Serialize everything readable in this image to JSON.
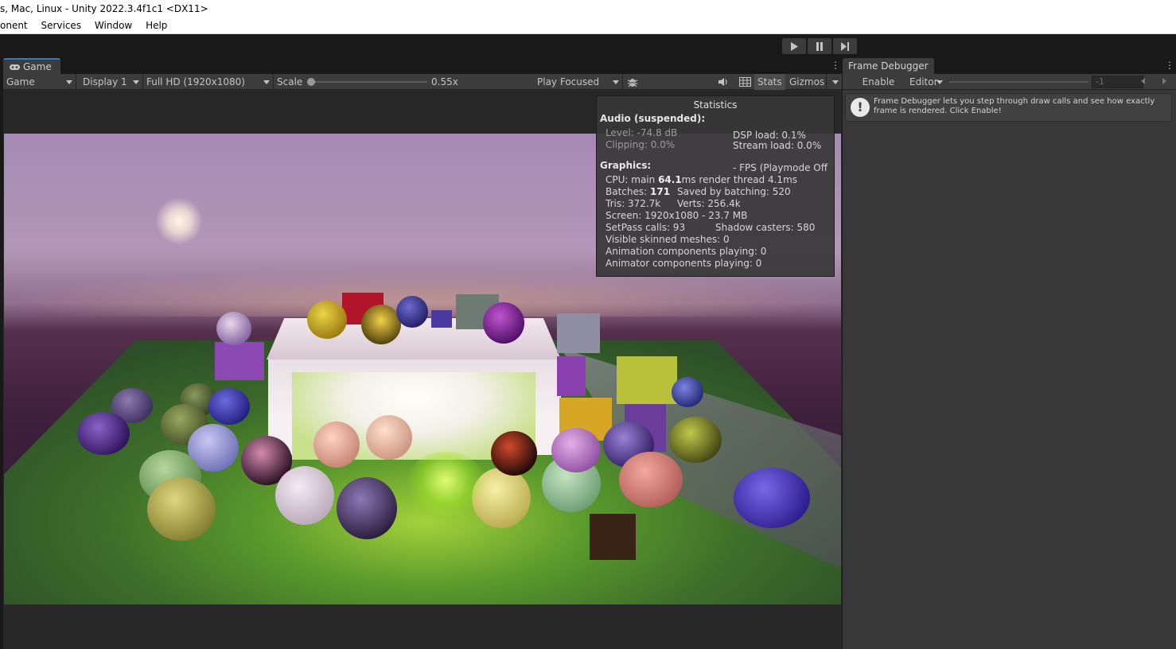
{
  "window": {
    "title": "s, Mac, Linux - Unity 2022.3.4f1c1 <DX11>"
  },
  "menu": {
    "items": [
      "onent",
      "Services",
      "Window",
      "Help"
    ]
  },
  "playbar": {
    "play_icon": "play-icon",
    "pause_icon": "pause-icon",
    "step_icon": "step-icon"
  },
  "game": {
    "tab_label": "Game",
    "view_dropdown": "Game",
    "display_dropdown": "Display 1",
    "resolution_dropdown": "Full HD (1920x1080)",
    "scale_label": "Scale",
    "scale_value": "0.55x",
    "scale_fraction": 0.0,
    "play_mode_dropdown": "Play Focused",
    "stats_label": "Stats",
    "gizmos_label": "Gizmos"
  },
  "statistics": {
    "title": "Statistics",
    "audio_header": "Audio (suspended):",
    "level": "Level: -74.8 dB",
    "clipping": "Clipping: 0.0%",
    "dsp_load": "DSP load: 0.1%",
    "stream_load": "Stream load: 0.0%",
    "graphics_header": "Graphics:",
    "fps": "- FPS (Playmode Off",
    "cpu_prefix": "CPU: main ",
    "cpu_main": "64.1",
    "cpu_suffix": "ms  render thread 4.1ms",
    "batches_prefix": "Batches: ",
    "batches": "171",
    "saved_batching": "Saved by batching: 520",
    "tris": "Tris: 372.7k",
    "verts": "Verts: 256.4k",
    "screen": "Screen: 1920x1080 - 23.7 MB",
    "setpass": "SetPass calls: 93",
    "shadow_casters": "Shadow casters: 580",
    "skinned": "Visible skinned meshes: 0",
    "animation": "Animation components playing: 0",
    "animator": "Animator components playing: 0"
  },
  "frame_debugger": {
    "tab_label": "Frame Debugger",
    "enable_label": "Enable",
    "editor_dropdown": "Editor",
    "event_index": "-1",
    "info_message": "Frame Debugger lets you step through draw calls and see how exactly frame is rendered. Click Enable!"
  },
  "colors": {
    "accent": "#3a79bb",
    "panel": "#383838",
    "toolbar": "#3c3c3c"
  }
}
